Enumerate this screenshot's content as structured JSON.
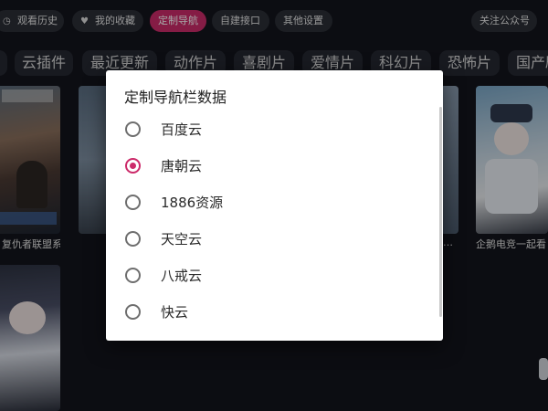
{
  "top_nav": {
    "history": {
      "label": "观看历史",
      "icon": "clock-icon"
    },
    "favorites": {
      "label": "我的收藏",
      "icon": "heart-icon"
    },
    "custom_nav": {
      "label": "定制导航"
    },
    "custom_api": {
      "label": "自建接口"
    },
    "other_settings": {
      "label": "其他设置"
    },
    "follow": {
      "label": "关注公众号"
    }
  },
  "categories": [
    "云插件",
    "最近更新",
    "动作片",
    "喜剧片",
    "爱情片",
    "科幻片",
    "恐怖片",
    "国产剧"
  ],
  "posters": [
    {
      "title": "复仇者联盟系列"
    },
    {
      "title": "企鹅电竞一起看 碧蓝航线"
    },
    {
      "title": "…"
    }
  ],
  "dialog": {
    "title": "定制导航栏数据",
    "options": [
      {
        "label": "百度云",
        "selected": false
      },
      {
        "label": "唐朝云",
        "selected": true
      },
      {
        "label": "1886资源",
        "selected": false
      },
      {
        "label": "天空云",
        "selected": false
      },
      {
        "label": "八戒云",
        "selected": false
      },
      {
        "label": "快云",
        "selected": false
      }
    ]
  },
  "colors": {
    "accent": "#cc2b6a",
    "background": "#13151c"
  }
}
